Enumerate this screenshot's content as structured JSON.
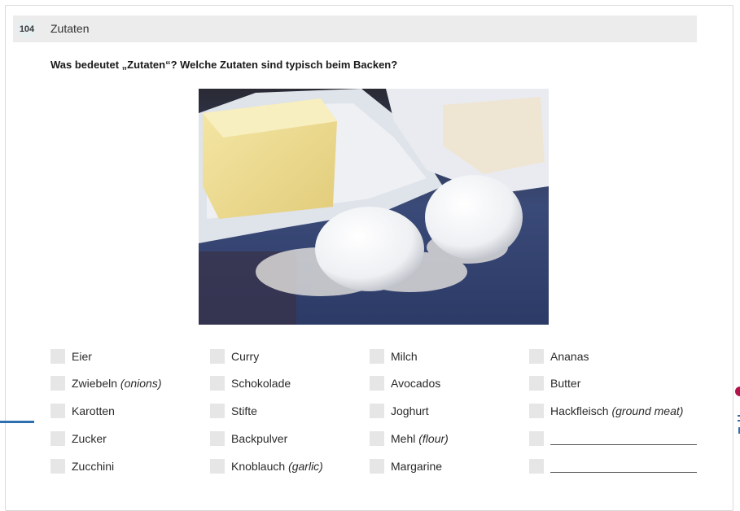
{
  "exercise": {
    "number": "104",
    "title": "Zutaten",
    "question": "Was bedeutet „Zutaten“? Welche Zutaten sind typisch beim Backen?"
  },
  "photo": {
    "subject": "butter-flour-eggs-photo"
  },
  "ingredients": [
    [
      {
        "text": "Eier",
        "note": ""
      },
      {
        "text": "Zwiebeln",
        "note": "(onions)"
      },
      {
        "text": "Karotten",
        "note": ""
      },
      {
        "text": "Zucker",
        "note": ""
      },
      {
        "text": "Zucchini",
        "note": ""
      }
    ],
    [
      {
        "text": "Curry",
        "note": ""
      },
      {
        "text": "Schokolade",
        "note": ""
      },
      {
        "text": "Stifte",
        "note": ""
      },
      {
        "text": "Backpulver",
        "note": ""
      },
      {
        "text": "Knoblauch",
        "note": "(garlic)"
      }
    ],
    [
      {
        "text": "Milch",
        "note": ""
      },
      {
        "text": "Avocados",
        "note": ""
      },
      {
        "text": "Joghurt",
        "note": ""
      },
      {
        "text": "Mehl",
        "note": "(flour)"
      },
      {
        "text": "Margarine",
        "note": ""
      }
    ],
    [
      {
        "text": "Ananas",
        "note": ""
      },
      {
        "text": "Butter",
        "note": ""
      },
      {
        "text": "Hackfleisch",
        "note": "(ground meat)"
      },
      {
        "text": "",
        "note": "",
        "blank": true
      },
      {
        "text": "",
        "note": "",
        "blank": true
      }
    ]
  ],
  "colors": {
    "checkbox": "#e6e6e6",
    "header": "#ececec",
    "accent": "#2d6fb0"
  }
}
